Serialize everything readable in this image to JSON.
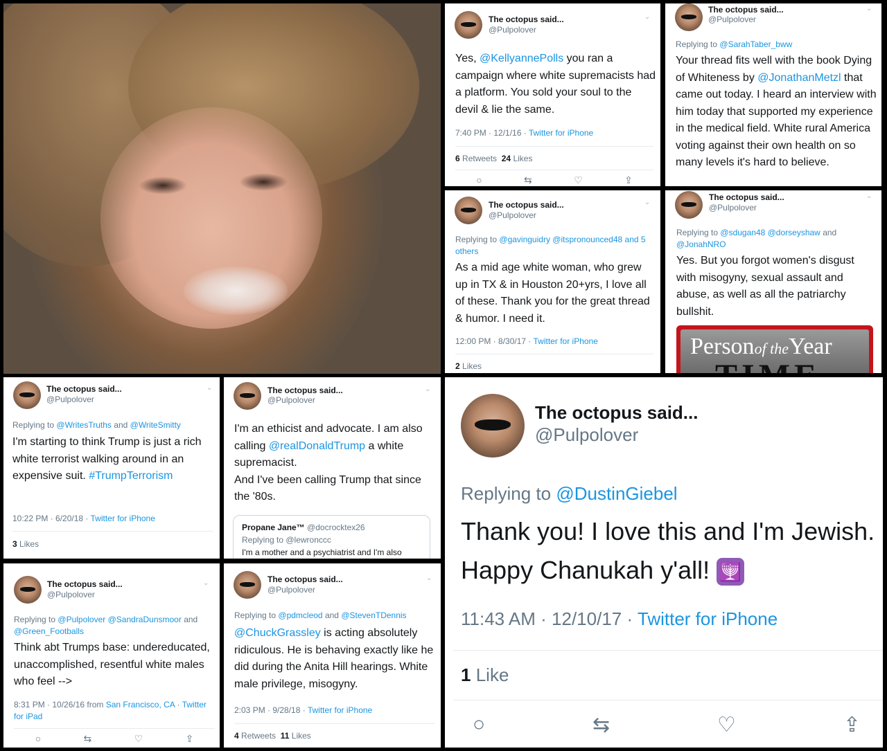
{
  "account": {
    "name": "The octopus said...",
    "handle": "@Pulpolover"
  },
  "ui": {
    "chevron": "⌄",
    "retweets_label": "Retweets",
    "likes_label": "Likes",
    "like_label": "Like",
    "replying_to": "Replying to",
    "and": "and",
    "from": "from"
  },
  "actions": {
    "reply": "○",
    "retweet": "⇆",
    "like": "♡",
    "share": "⇪"
  },
  "tweets": [
    {
      "body_pre": "Yes, ",
      "body_mention": "@KellyannePolls",
      "body_post": " you ran a campaign where white supremacists had a platform. You sold your soul to the devil & lie the same.",
      "time": "7:40 PM · 12/1/16 · ",
      "source": "Twitter for iPhone",
      "retweets": "6",
      "likes": "24"
    },
    {
      "reply_to": "@SarahTaber_bww",
      "body_pre": "Your thread fits well with the book Dying of Whiteness by ",
      "body_mention": "@JonathanMetzl",
      "body_post": " that came out today. I heard an interview with him today that supported my experience in the medical field. White rural America voting against their own health on so many levels it's hard to believe."
    },
    {
      "reply_to": "@gavinguidry @itspronounced48 and 5 others",
      "body": "As a mid age white woman, who grew up in TX & in Houston 20+yrs, I love all of these. Thank you for the great thread & humor. I need it.",
      "time": "12:00 PM · 8/30/17 · ",
      "source": "Twitter for iPhone",
      "likes": "2"
    },
    {
      "reply_to_a": "@sdugan48 @dorseyshaw",
      "reply_to_b": "@JonahNRO",
      "body": "Yes. But you forgot women's disgust with misogyny, sexual assault and abuse, as well as all the patriarchy bullshit.",
      "magazine": {
        "title_a": "Person",
        "title_b": "of the",
        "title_c": "Year",
        "masthead": "TIME"
      }
    },
    {
      "reply_to_a": "@WritesTruths",
      "reply_to_b": "@WriteSmitty",
      "body": "I'm starting to think Trump is just a rich white terrorist walking around in an expensive suit.",
      "hashtag": "#TrumpTerrorism",
      "time": "10:22 PM · 6/20/18 · ",
      "source": "Twitter for iPhone",
      "likes": "3"
    },
    {
      "body_a": "I'm an ethicist and advocate. I am also calling ",
      "body_mention": "@realDonaldTrump",
      "body_b": " a white supremacist.",
      "body_c": "And I've been calling Trump that since the '80s.",
      "quote": {
        "name": "Propane Jane™",
        "handle": "@docrocktex26",
        "reply": "Replying to @lewronccc",
        "text": "I'm a mother and a psychiatrist and I'm also"
      }
    },
    {
      "reply_to_a": "@Pulpolover @SandraDunsmoor",
      "reply_to_b": "@Green_Footballs",
      "body": "Think abt Trumps base: undereducated, unaccomplished, resentful white males who feel -->",
      "time": "8:31 PM · 10/26/16 ",
      "location": "San Francisco, CA",
      "source": "Twitter for iPad"
    },
    {
      "reply_to_a": "@pdmcleod",
      "reply_to_b": "@StevenTDennis",
      "body_mention": "@ChuckGrassley",
      "body_post": " is acting absolutely ridiculous. He is behaving exactly like he did during the Anita Hill hearings. White male privilege, misogyny.",
      "time": "2:03 PM · 9/28/18 · ",
      "source": "Twitter for iPhone",
      "retweets": "4",
      "likes": "11"
    },
    {
      "reply_to": "@DustinGiebel",
      "body": "Thank you! I love this and I'm Jewish. Happy Chanukah y'all!",
      "emoji": "🕎",
      "time": "11:43 AM · 12/10/17 · ",
      "source": "Twitter for iPhone",
      "likes": "1"
    }
  ]
}
